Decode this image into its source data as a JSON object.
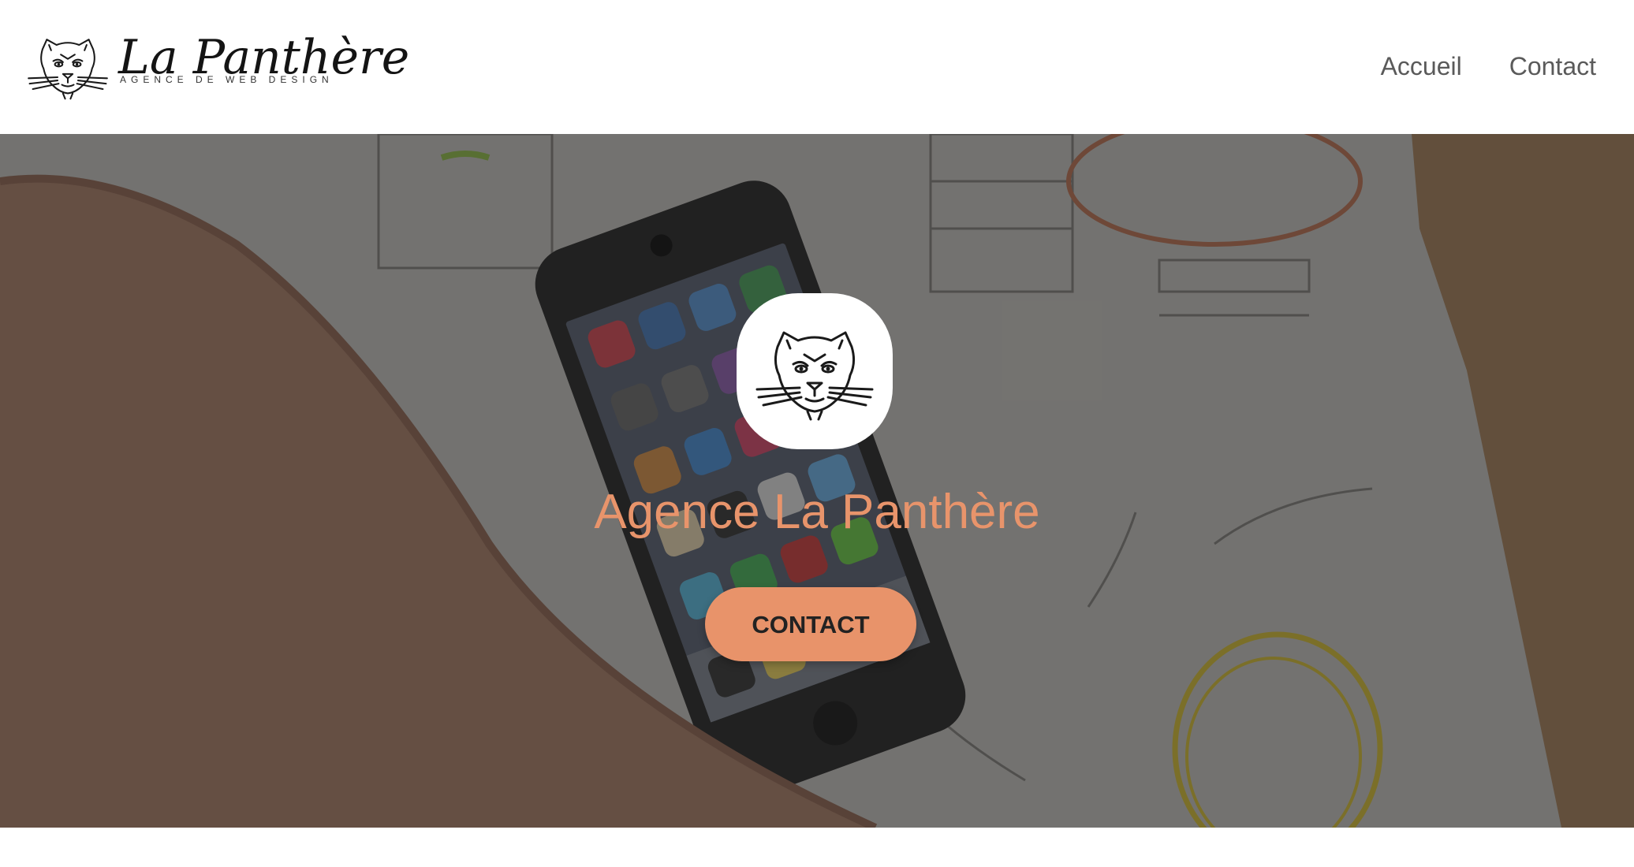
{
  "brand": {
    "name": "La Panthère",
    "tagline": "AGENCE DE WEB DESIGN",
    "logo_icon": "panther-head-icon"
  },
  "nav": {
    "items": [
      {
        "label": "Accueil"
      },
      {
        "label": "Contact"
      }
    ]
  },
  "hero": {
    "logo_icon": "panther-head-icon",
    "title": "Agence La Panthère",
    "button_label": "CONTACT",
    "background": "photo-of-smartphone-on-wireframe-sketches"
  },
  "colors": {
    "accent": "#e8936a",
    "nav_text": "#5a5a5a",
    "header_bg": "#ffffff"
  }
}
